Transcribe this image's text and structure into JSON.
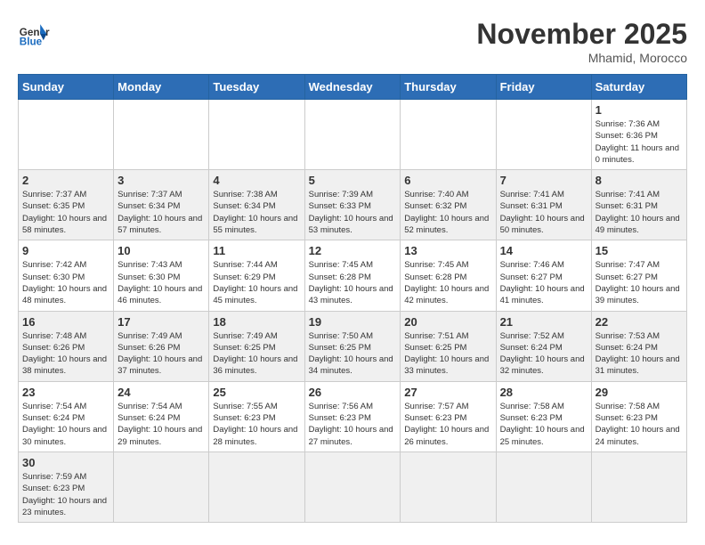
{
  "logo": {
    "text_general": "General",
    "text_blue": "Blue"
  },
  "title": "November 2025",
  "location": "Mhamid, Morocco",
  "days_of_week": [
    "Sunday",
    "Monday",
    "Tuesday",
    "Wednesday",
    "Thursday",
    "Friday",
    "Saturday"
  ],
  "weeks": [
    [
      {
        "day": "",
        "info": ""
      },
      {
        "day": "",
        "info": ""
      },
      {
        "day": "",
        "info": ""
      },
      {
        "day": "",
        "info": ""
      },
      {
        "day": "",
        "info": ""
      },
      {
        "day": "",
        "info": ""
      },
      {
        "day": "1",
        "info": "Sunrise: 7:36 AM\nSunset: 6:36 PM\nDaylight: 11 hours and 0 minutes."
      }
    ],
    [
      {
        "day": "2",
        "info": "Sunrise: 7:37 AM\nSunset: 6:35 PM\nDaylight: 10 hours and 58 minutes."
      },
      {
        "day": "3",
        "info": "Sunrise: 7:37 AM\nSunset: 6:34 PM\nDaylight: 10 hours and 57 minutes."
      },
      {
        "day": "4",
        "info": "Sunrise: 7:38 AM\nSunset: 6:34 PM\nDaylight: 10 hours and 55 minutes."
      },
      {
        "day": "5",
        "info": "Sunrise: 7:39 AM\nSunset: 6:33 PM\nDaylight: 10 hours and 53 minutes."
      },
      {
        "day": "6",
        "info": "Sunrise: 7:40 AM\nSunset: 6:32 PM\nDaylight: 10 hours and 52 minutes."
      },
      {
        "day": "7",
        "info": "Sunrise: 7:41 AM\nSunset: 6:31 PM\nDaylight: 10 hours and 50 minutes."
      },
      {
        "day": "8",
        "info": "Sunrise: 7:41 AM\nSunset: 6:31 PM\nDaylight: 10 hours and 49 minutes."
      }
    ],
    [
      {
        "day": "9",
        "info": "Sunrise: 7:42 AM\nSunset: 6:30 PM\nDaylight: 10 hours and 48 minutes."
      },
      {
        "day": "10",
        "info": "Sunrise: 7:43 AM\nSunset: 6:30 PM\nDaylight: 10 hours and 46 minutes."
      },
      {
        "day": "11",
        "info": "Sunrise: 7:44 AM\nSunset: 6:29 PM\nDaylight: 10 hours and 45 minutes."
      },
      {
        "day": "12",
        "info": "Sunrise: 7:45 AM\nSunset: 6:28 PM\nDaylight: 10 hours and 43 minutes."
      },
      {
        "day": "13",
        "info": "Sunrise: 7:45 AM\nSunset: 6:28 PM\nDaylight: 10 hours and 42 minutes."
      },
      {
        "day": "14",
        "info": "Sunrise: 7:46 AM\nSunset: 6:27 PM\nDaylight: 10 hours and 41 minutes."
      },
      {
        "day": "15",
        "info": "Sunrise: 7:47 AM\nSunset: 6:27 PM\nDaylight: 10 hours and 39 minutes."
      }
    ],
    [
      {
        "day": "16",
        "info": "Sunrise: 7:48 AM\nSunset: 6:26 PM\nDaylight: 10 hours and 38 minutes."
      },
      {
        "day": "17",
        "info": "Sunrise: 7:49 AM\nSunset: 6:26 PM\nDaylight: 10 hours and 37 minutes."
      },
      {
        "day": "18",
        "info": "Sunrise: 7:49 AM\nSunset: 6:25 PM\nDaylight: 10 hours and 36 minutes."
      },
      {
        "day": "19",
        "info": "Sunrise: 7:50 AM\nSunset: 6:25 PM\nDaylight: 10 hours and 34 minutes."
      },
      {
        "day": "20",
        "info": "Sunrise: 7:51 AM\nSunset: 6:25 PM\nDaylight: 10 hours and 33 minutes."
      },
      {
        "day": "21",
        "info": "Sunrise: 7:52 AM\nSunset: 6:24 PM\nDaylight: 10 hours and 32 minutes."
      },
      {
        "day": "22",
        "info": "Sunrise: 7:53 AM\nSunset: 6:24 PM\nDaylight: 10 hours and 31 minutes."
      }
    ],
    [
      {
        "day": "23",
        "info": "Sunrise: 7:54 AM\nSunset: 6:24 PM\nDaylight: 10 hours and 30 minutes."
      },
      {
        "day": "24",
        "info": "Sunrise: 7:54 AM\nSunset: 6:24 PM\nDaylight: 10 hours and 29 minutes."
      },
      {
        "day": "25",
        "info": "Sunrise: 7:55 AM\nSunset: 6:23 PM\nDaylight: 10 hours and 28 minutes."
      },
      {
        "day": "26",
        "info": "Sunrise: 7:56 AM\nSunset: 6:23 PM\nDaylight: 10 hours and 27 minutes."
      },
      {
        "day": "27",
        "info": "Sunrise: 7:57 AM\nSunset: 6:23 PM\nDaylight: 10 hours and 26 minutes."
      },
      {
        "day": "28",
        "info": "Sunrise: 7:58 AM\nSunset: 6:23 PM\nDaylight: 10 hours and 25 minutes."
      },
      {
        "day": "29",
        "info": "Sunrise: 7:58 AM\nSunset: 6:23 PM\nDaylight: 10 hours and 24 minutes."
      }
    ],
    [
      {
        "day": "30",
        "info": "Sunrise: 7:59 AM\nSunset: 6:23 PM\nDaylight: 10 hours and 23 minutes."
      },
      {
        "day": "",
        "info": ""
      },
      {
        "day": "",
        "info": ""
      },
      {
        "day": "",
        "info": ""
      },
      {
        "day": "",
        "info": ""
      },
      {
        "day": "",
        "info": ""
      },
      {
        "day": "",
        "info": ""
      }
    ]
  ]
}
